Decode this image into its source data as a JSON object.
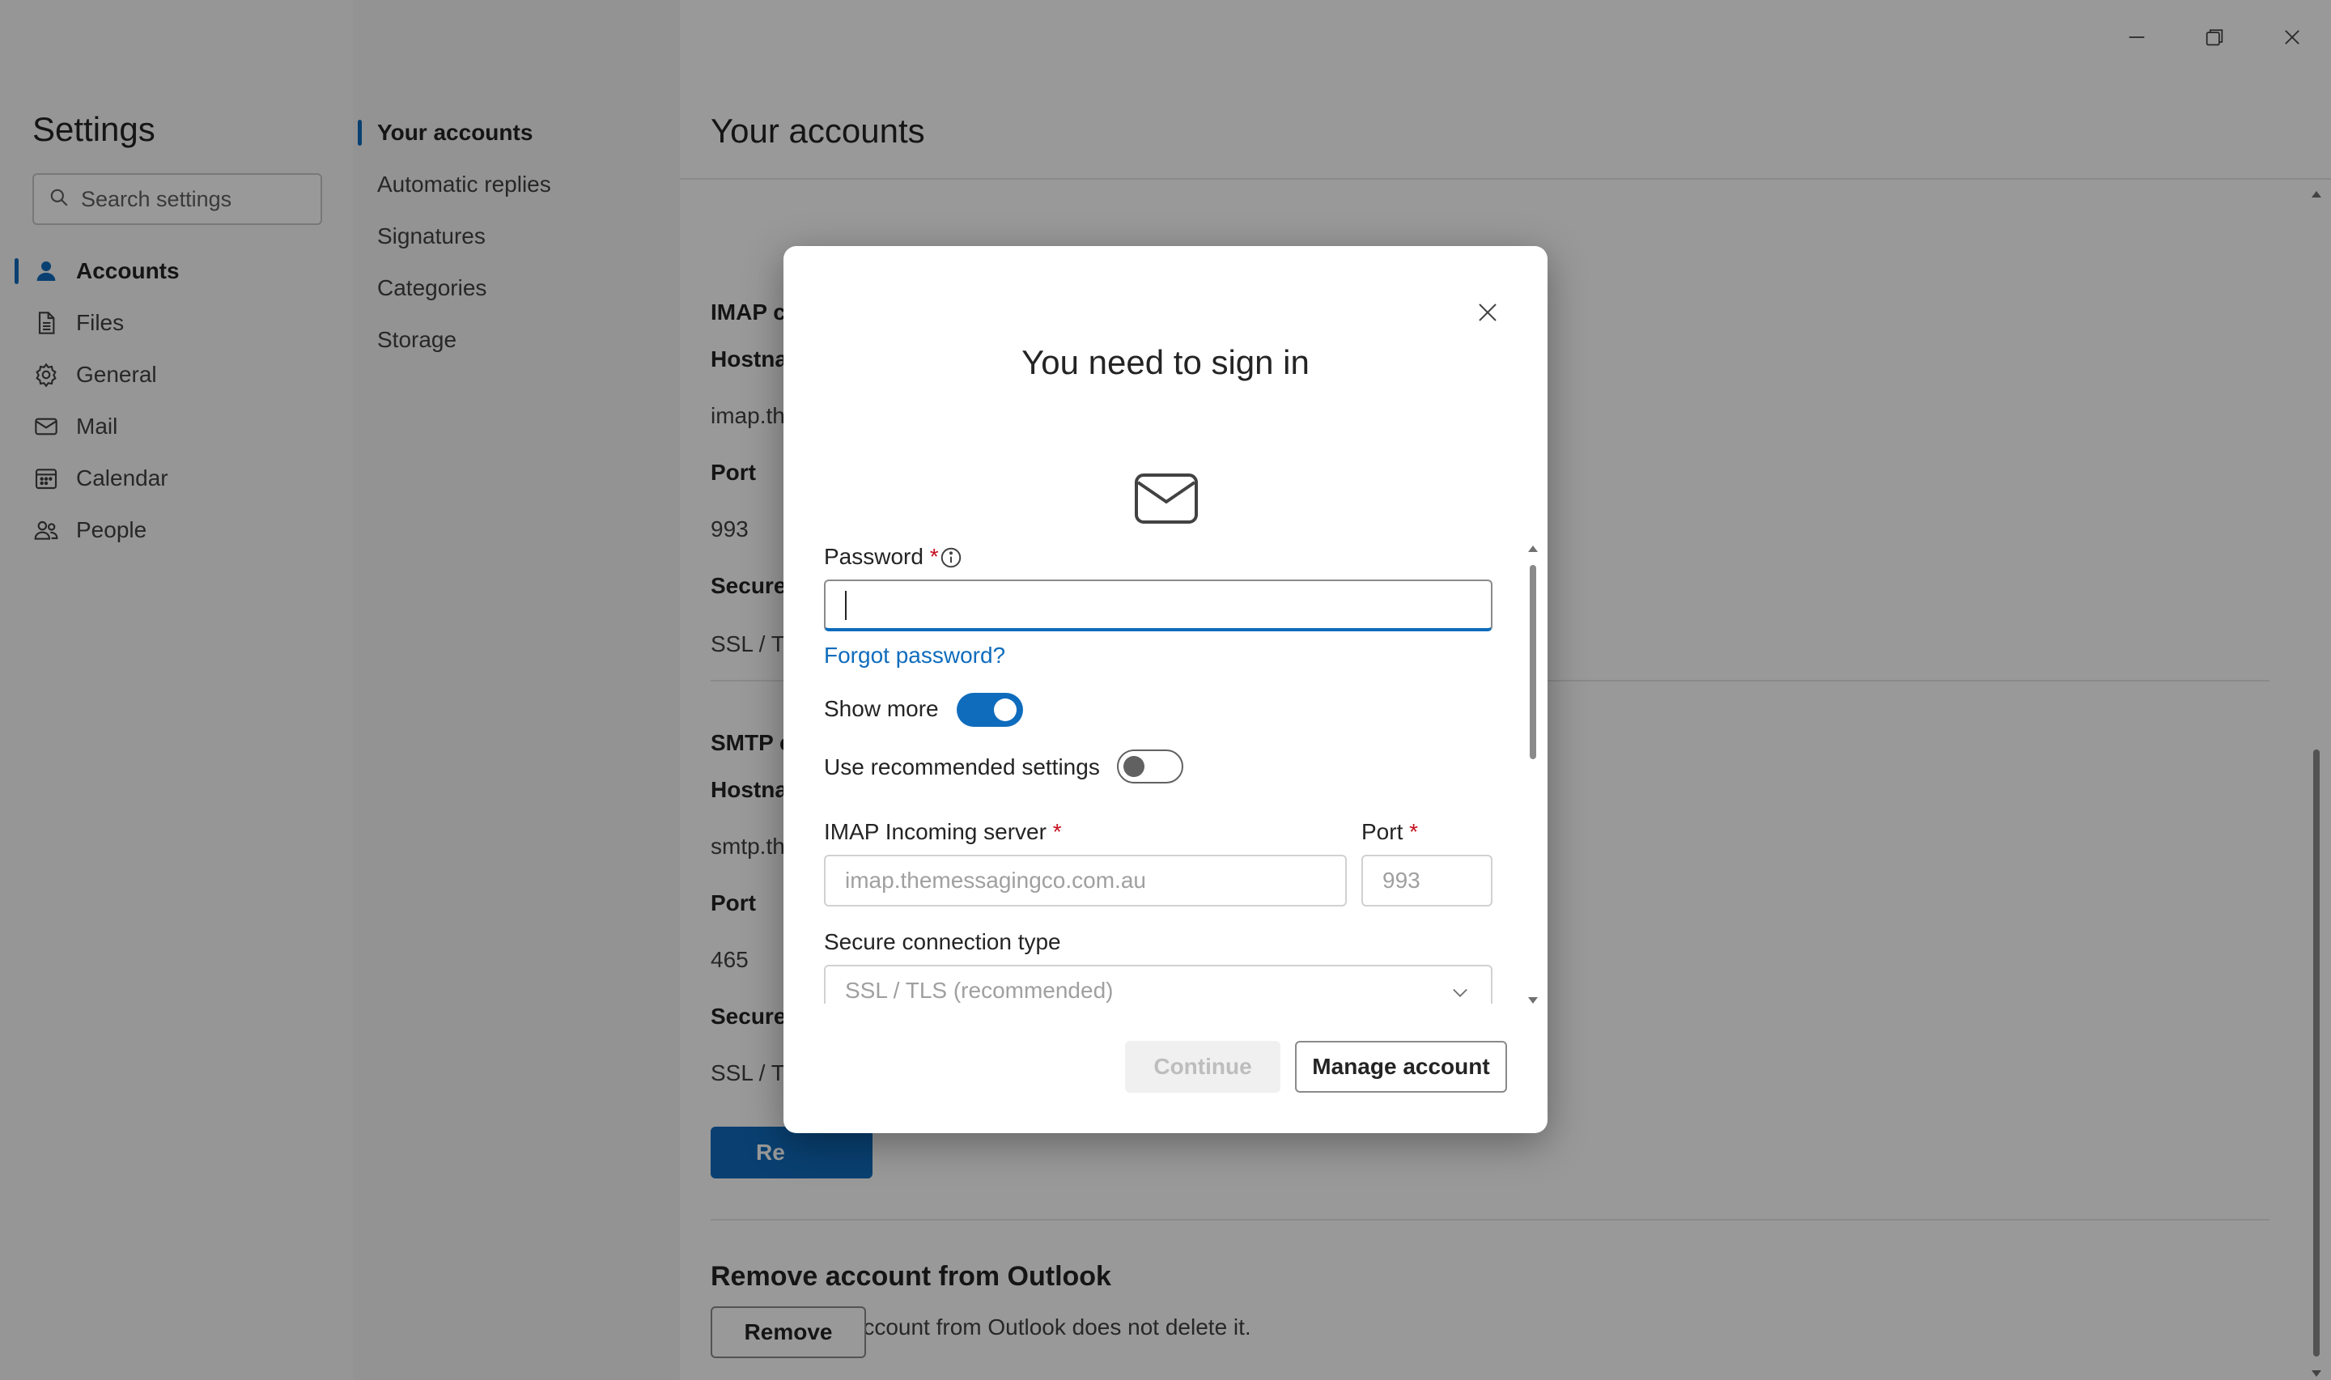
{
  "settings": {
    "title": "Settings",
    "search_placeholder": "Search settings"
  },
  "nav": {
    "items": [
      {
        "label": "Accounts",
        "icon": "person-icon",
        "active": true
      },
      {
        "label": "Files",
        "icon": "file-icon"
      },
      {
        "label": "General",
        "icon": "gear-icon"
      },
      {
        "label": "Mail",
        "icon": "mail-icon"
      },
      {
        "label": "Calendar",
        "icon": "calendar-icon"
      },
      {
        "label": "People",
        "icon": "people-icon"
      }
    ]
  },
  "subnav": {
    "items": [
      {
        "label": "Your accounts",
        "active": true
      },
      {
        "label": "Automatic replies"
      },
      {
        "label": "Signatures"
      },
      {
        "label": "Categories"
      },
      {
        "label": "Storage"
      }
    ]
  },
  "window_controls": {
    "minimize": "minimize-icon",
    "restore": "restore-icon",
    "close": "close-icon"
  },
  "main": {
    "title": "Your accounts",
    "imap": {
      "section_title": "IMAP configuration",
      "hostname_label": "Hostna",
      "hostname_value": "imap.th",
      "port_label": "Port",
      "port_value": "993",
      "secure_label": "Secure",
      "secure_value": "SSL / TI"
    },
    "smtp": {
      "section_title": "SMTP c",
      "hostname_label": "Hostna",
      "hostname_value": "smtp.th",
      "port_label": "Port",
      "port_value": "465",
      "secure_label": "Secure",
      "secure_value": "SSL / TI"
    },
    "primary_button_label": "Re",
    "remove": {
      "title": "Remove account from Outlook",
      "description": "Removing an account from Outlook does not delete it.",
      "button_label": "Remove"
    }
  },
  "dialog": {
    "title": "You need to sign in",
    "password_label": "Password",
    "required_mark": "*",
    "forgot_password": "Forgot password?",
    "show_more_label": "Show more",
    "show_more_on": true,
    "recommended_label": "Use recommended settings",
    "recommended_on": false,
    "imap_server_label": "IMAP Incoming server",
    "imap_server_value": "imap.themessagingco.com.au",
    "port_label": "Port",
    "port_value": "993",
    "secure_type_label": "Secure connection type",
    "secure_type_value": "SSL / TLS (recommended)",
    "continue_label": "Continue",
    "manage_label": "Manage account"
  },
  "colors": {
    "accent": "#0f6cbd",
    "required": "#c50f1f"
  }
}
